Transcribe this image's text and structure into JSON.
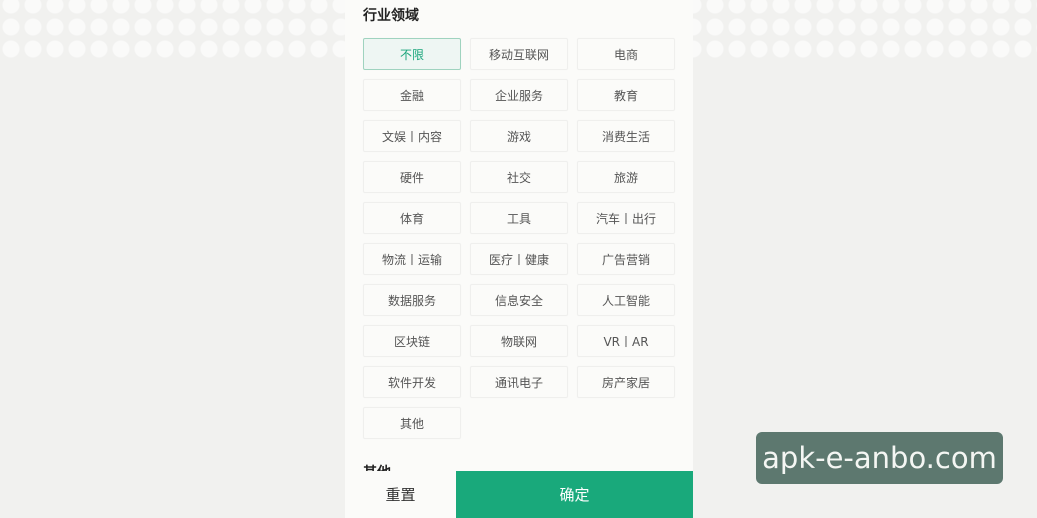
{
  "filter": {
    "section_title": "行业领域",
    "next_section_peek": "其他",
    "selected_index": 0,
    "tags": [
      "不限",
      "移动互联网",
      "电商",
      "金融",
      "企业服务",
      "教育",
      "文娱丨内容",
      "游戏",
      "消费生活",
      "硬件",
      "社交",
      "旅游",
      "体育",
      "工具",
      "汽车丨出行",
      "物流丨运输",
      "医疗丨健康",
      "广告营销",
      "数据服务",
      "信息安全",
      "人工智能",
      "区块链",
      "物联网",
      "VR丨AR",
      "软件开发",
      "通讯电子",
      "房产家居",
      "其他"
    ]
  },
  "actions": {
    "reset_label": "重置",
    "confirm_label": "确定"
  },
  "watermark": {
    "text": "apk-e-anbo.com"
  },
  "colors": {
    "accent": "#19a97b",
    "selected_text": "#1aa57b",
    "selected_bg": "#eef6f3"
  }
}
